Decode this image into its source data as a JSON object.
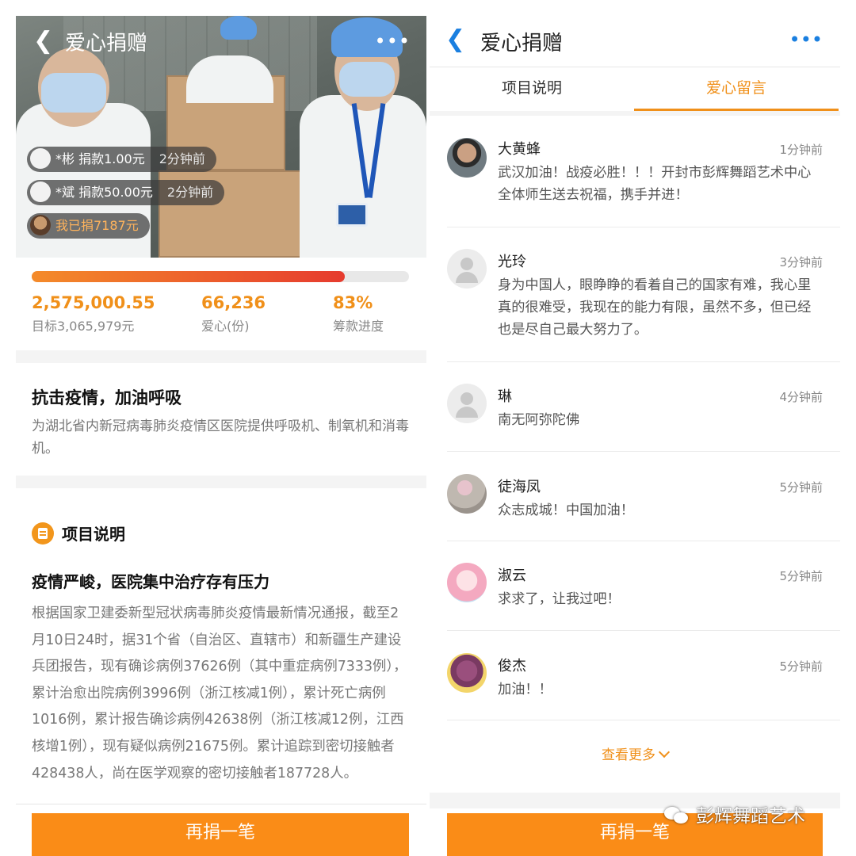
{
  "left": {
    "header": {
      "title": "爱心捐赠",
      "more": "•••"
    },
    "donations": [
      {
        "text": "*彬 捐款1.00元",
        "time": "2分钟前"
      },
      {
        "text": "*斌 捐款50.00元",
        "time": "2分钟前"
      }
    ],
    "my_donation": "我已捐7187元",
    "progress": {
      "percent": 83
    },
    "stats": {
      "raised": "2,575,000.55",
      "target": "目标3,065,979元",
      "love_count": "66,236",
      "love_label": "爱心(份)",
      "progress_value": "83%",
      "progress_label": "筹款进度"
    },
    "campaign": {
      "title": "抗击疫情，加油呼吸",
      "description": "为湖北省内新冠病毒肺炎疫情区医院提供呼吸机、制氧机和消毒机。"
    },
    "section": {
      "title": "项目说明"
    },
    "article": {
      "title": "疫情严峻，医院集中治疗存有压力",
      "body": "根据国家卫建委新型冠状病毒肺炎疫情最新情况通报，截至2月10日24时，据31个省（自治区、直辖市）和新疆生产建设兵团报告，现有确诊病例37626例（其中重症病例7333例），累计治愈出院病例3996例（浙江核减1例），累计死亡病例1016例，累计报告确诊病例42638例（浙江核减12例，江西核增1例），现有疑似病例21675例。累计追踪到密切接触者428438人，尚在医学观察的密切接触者187728人。"
    },
    "donate_button": "再捐一笔"
  },
  "right": {
    "header": {
      "title": "爱心捐赠",
      "more": "•••"
    },
    "tabs": [
      {
        "label": "项目说明",
        "active": false
      },
      {
        "label": "爱心留言",
        "active": true
      }
    ],
    "messages": [
      {
        "name": "大黄蜂",
        "time": "1分钟前",
        "text": "武汉加油！战疫必胜！！！开封市彭辉舞蹈艺术中心全体师生送去祝福，携手并进！"
      },
      {
        "name": "光玲",
        "time": "3分钟前",
        "text": "身为中国人，眼睁睁的看着自己的国家有难，我心里真的很难受，我现在的能力有限，虽然不多，但已经也是尽自己最大努力了。"
      },
      {
        "name": "琳",
        "time": "4分钟前",
        "text": "南无阿弥陀佛"
      },
      {
        "name": "徒海凤",
        "time": "5分钟前",
        "text": "众志成城！中国加油！"
      },
      {
        "name": "淑云",
        "time": "5分钟前",
        "text": "求求了，让我过吧！"
      },
      {
        "name": "俊杰",
        "time": "5分钟前",
        "text": "加油！！"
      }
    ],
    "see_more": "查看更多",
    "donate_button": "再捐一笔"
  },
  "watermark": "彭辉舞蹈艺术",
  "colors": {
    "accent": "#f0901a",
    "link_blue": "#1a7fe0",
    "progress_start": "#f48b2a",
    "progress_end": "#e63b2e"
  }
}
